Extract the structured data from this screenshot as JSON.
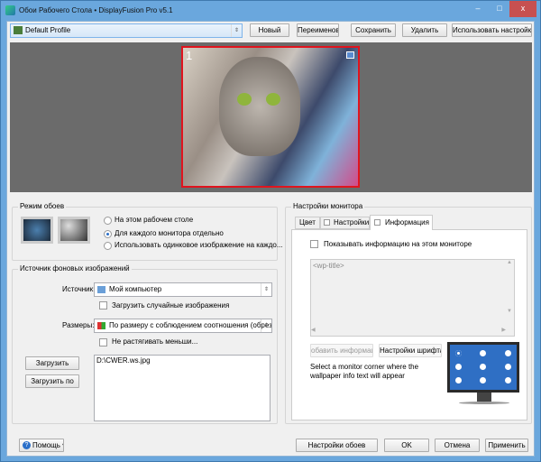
{
  "window": {
    "title": "Обои Рабочего Стола • DisplayFusion Pro v5.1",
    "minimize": "–",
    "maximize": "□",
    "close": "x"
  },
  "profile": {
    "selected": "Default Profile",
    "new": "Новый",
    "rename": "Переименов",
    "save": "Сохранить",
    "delete": "Удалить",
    "use_settings": "Использовать настройки"
  },
  "preview": {
    "monitor_number": "1"
  },
  "mode": {
    "group_label": "Режим обоев",
    "options": [
      "На этом рабочем столе",
      "Для каждого монитора отдельно",
      "Использовать одинковое изображение на каждо..."
    ],
    "selected_index": 1
  },
  "source": {
    "group_label": "Источник фоновых изображений",
    "source_label": "Источник:",
    "source_value": "Мой компьютер",
    "random_label": "Загрузить случайные изображения",
    "size_label": "Размеры:",
    "size_value": "По размеру с соблюдением соотношения (обреза...",
    "no_stretch_label": "Не растягивать меньши...",
    "load_button": "Загрузить",
    "load_url_button": "Загрузить по",
    "files": [
      "D:\\CWER.ws.jpg"
    ]
  },
  "monitor_settings": {
    "group_label": "Настройки монитора",
    "tabs": [
      "Цвет",
      "Настройки",
      "Информация"
    ],
    "active_tab": 2,
    "show_info_label": "Показывать информацию на этом мониторе",
    "info_text": "<wp-title>",
    "add_info_button": "обавить информацию",
    "font_settings_button": "Настройки шрифта",
    "corner_hint": "Select a monitor corner where the wallpaper info text will appear"
  },
  "footer": {
    "help": "Помощь",
    "wallpaper_settings": "Настройки обоев",
    "ok": "OK",
    "cancel": "Отмена",
    "apply": "Применить"
  },
  "colors": {
    "accent": "#2a6fc9",
    "frame": "#6aa7dd",
    "preview_bg": "#6b6b6b",
    "selected_border": "#e0141e"
  }
}
